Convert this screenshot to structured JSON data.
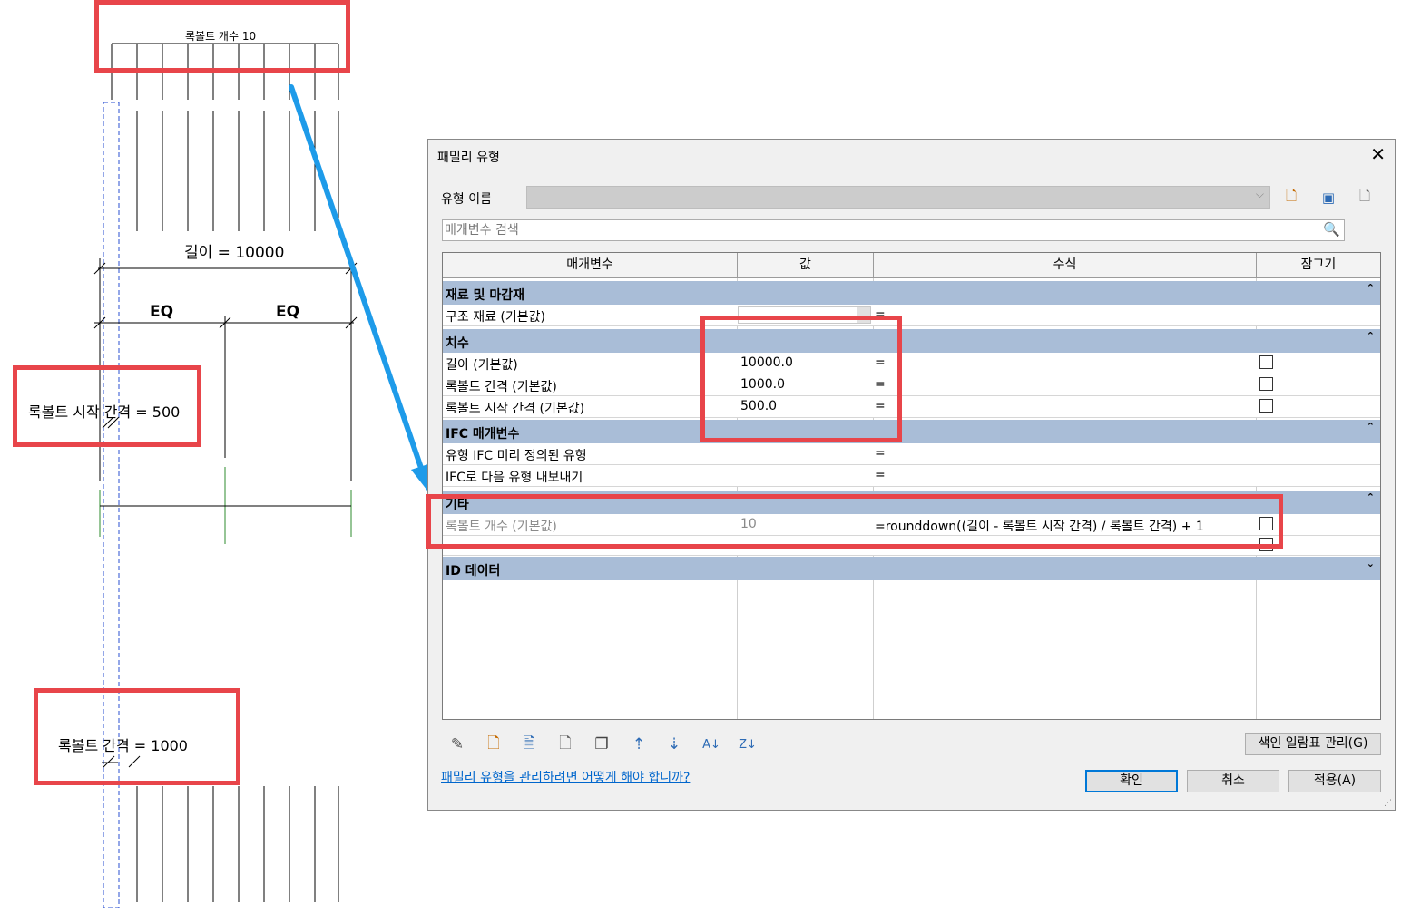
{
  "drawing": {
    "bolt_count_label": "록볼트 개수 10",
    "length_label": "길이 = 10000",
    "eq_left": "EQ",
    "eq_right": "EQ",
    "start_spacing_label": "록볼트 시작 간격 = 500",
    "spacing_label": "록볼트 간격 = 1000"
  },
  "dialog": {
    "title": "패밀리 유형",
    "close_glyph": "✕",
    "type_name_label": "유형 이름",
    "type_name_value": "",
    "search_placeholder": "매개변수 검색",
    "columns": {
      "parameter": "매개변수",
      "value": "값",
      "formula": "수식",
      "lock": "잠그기"
    },
    "groups": {
      "materials": "재료 및 마감재",
      "dimensions": "치수",
      "ifc": "IFC 매개변수",
      "other": "기타",
      "identity": "ID 데이터"
    },
    "rows": {
      "structural_material": {
        "name": "구조 재료 (기본값)",
        "value": "",
        "formula": "="
      },
      "length": {
        "name": "길이 (기본값)",
        "value": "10000.0",
        "formula": "="
      },
      "bolt_spacing": {
        "name": "록볼트 간격 (기본값)",
        "value": "1000.0",
        "formula": "="
      },
      "bolt_start_spacing": {
        "name": "록볼트 시작 간격 (기본값)",
        "value": "500.0",
        "formula": "="
      },
      "ifc_predefined_type": {
        "name": "유형 IFC 미리 정의된 유형",
        "value": "",
        "formula": "="
      },
      "ifc_export_as": {
        "name": "IFC로 다음 유형 내보내기",
        "value": "",
        "formula": "="
      },
      "bolt_count": {
        "name": "록볼트 개수 (기본값)",
        "value": "10",
        "formula": "=rounddown((길이 - 록볼트 시작 간격) / 록볼트 간격) + 1"
      },
      "hidden_row": {
        "name": "",
        "value": "",
        "formula": ""
      }
    },
    "manage_lookup_label": "색인 일람표 관리(G)",
    "help_link": "패밀리 유형을 관리하려면 어떻게 해야 합니까?",
    "ok_label": "확인",
    "cancel_label": "취소",
    "apply_label": "적용(A)"
  },
  "colors": {
    "highlight_red": "#e8454a",
    "arrow_blue": "#1e9be9",
    "group_header_blue": "#a9bdd7",
    "reference_green": "#2e8b2e",
    "ok_border": "#0078d7"
  },
  "icons": {
    "toolbar_top": [
      "new-type-icon",
      "rename-type-icon",
      "delete-type-icon"
    ],
    "toolbar_bottom": [
      "edit-parameter-icon",
      "new-parameter-icon",
      "delete-parameter-icon",
      "duplicate-parameter-icon",
      "copy-icon",
      "move-up-icon",
      "move-down-icon",
      "sort-ascending-icon",
      "sort-descending-icon"
    ]
  }
}
